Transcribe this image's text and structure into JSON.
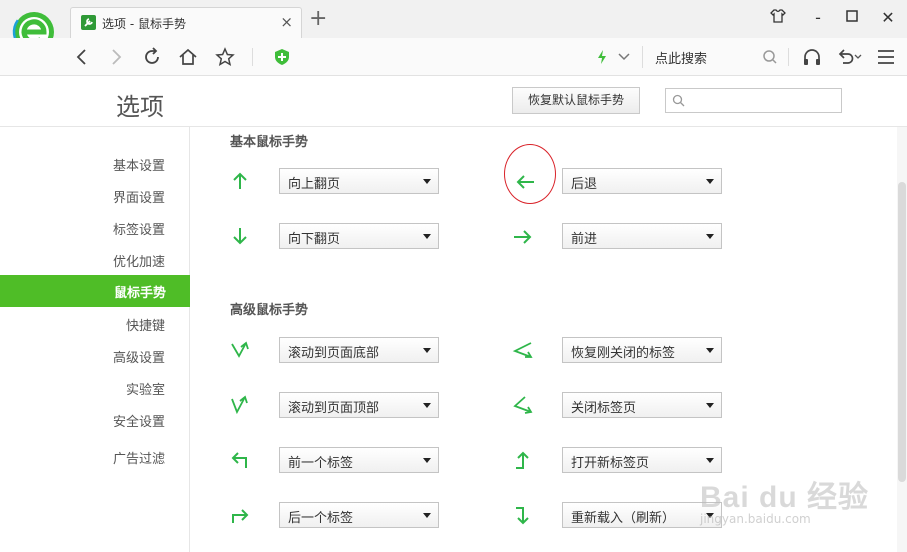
{
  "browser": {
    "tab_title": "选项 - 鼠标手势",
    "tab_close": "×",
    "new_tab": "+",
    "search_text": "点此搜索",
    "accent": "#2fb64a"
  },
  "window": {
    "minimize": "-",
    "maximize": "□",
    "close": "✕"
  },
  "header": {
    "title": "选项",
    "reset_label": "恢复默认鼠标手势",
    "search_value": ""
  },
  "sidebar": {
    "active_color": "#4fbd27",
    "items": [
      {
        "label": "基本设置"
      },
      {
        "label": "界面设置"
      },
      {
        "label": "标签设置"
      },
      {
        "label": "优化加速"
      },
      {
        "label": "鼠标手势"
      },
      {
        "label": "快捷键"
      },
      {
        "label": "高级设置"
      },
      {
        "label": "实验室"
      },
      {
        "label": "安全设置"
      },
      {
        "label": "广告过滤"
      }
    ]
  },
  "basic": {
    "title": "基本鼠标手势",
    "gestures": [
      {
        "icon": "arrow-up-icon",
        "action": "向上翻页"
      },
      {
        "icon": "arrow-left-icon",
        "action": "后退"
      },
      {
        "icon": "arrow-down-icon",
        "action": "向下翻页"
      },
      {
        "icon": "arrow-right-icon",
        "action": "前进"
      }
    ]
  },
  "advanced": {
    "title": "高级鼠标手势",
    "gestures": [
      {
        "icon": "down-up-zigzag-icon",
        "action": "滚动到页面底部"
      },
      {
        "icon": "left-right-zigzag-icon",
        "action": "恢复刚关闭的标签"
      },
      {
        "icon": "up-down-zigzag-icon",
        "action": "滚动到页面顶部"
      },
      {
        "icon": "right-left-zigzag-icon",
        "action": "关闭标签页"
      },
      {
        "icon": "up-left-turn-icon",
        "action": "前一个标签"
      },
      {
        "icon": "right-up-turn-icon",
        "action": "打开新标签页"
      },
      {
        "icon": "down-right-turn-icon",
        "action": "后一个标签"
      },
      {
        "icon": "right-down-turn-icon",
        "action": "重新载入（刷新）"
      }
    ]
  },
  "watermark": {
    "brand": "Bai du 经验",
    "url": "jingyan.baidu.com"
  }
}
